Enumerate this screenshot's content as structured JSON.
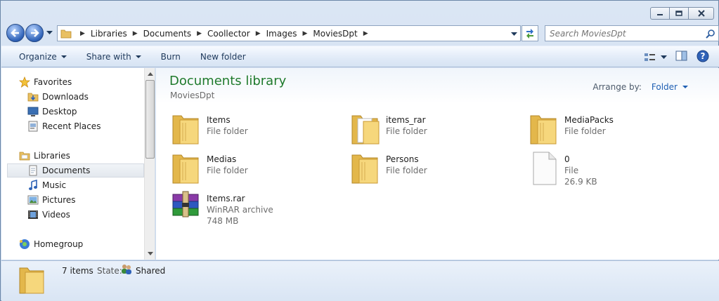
{
  "address": {
    "crumbs": [
      "Libraries",
      "Documents",
      "Coollector",
      "Images",
      "MoviesDpt"
    ]
  },
  "search": {
    "placeholder": "Search MoviesDpt"
  },
  "toolbar": {
    "organize": "Organize",
    "share_with": "Share with",
    "burn": "Burn",
    "new_folder": "New folder"
  },
  "nav": {
    "favorites": "Favorites",
    "downloads": "Downloads",
    "desktop": "Desktop",
    "recent_places": "Recent Places",
    "libraries": "Libraries",
    "documents": "Documents",
    "music": "Music",
    "pictures": "Pictures",
    "videos": "Videos",
    "homegroup": "Homegroup"
  },
  "content": {
    "title": "Documents library",
    "subtitle": "MoviesDpt",
    "arrange_label": "Arrange by:",
    "arrange_value": "Folder",
    "files": [
      {
        "name": "Items",
        "type": "File folder",
        "size": ""
      },
      {
        "name": "items_rar",
        "type": "File folder",
        "size": ""
      },
      {
        "name": "MediaPacks",
        "type": "File folder",
        "size": ""
      },
      {
        "name": "Medias",
        "type": "File folder",
        "size": ""
      },
      {
        "name": "Persons",
        "type": "File folder",
        "size": ""
      },
      {
        "name": "0",
        "type": "File",
        "size": "26.9 KB"
      },
      {
        "name": "Items.rar",
        "type": "WinRAR archive",
        "size": "748 MB"
      }
    ]
  },
  "details": {
    "count": "7 items",
    "state_label": "State:",
    "state_value": "Shared"
  },
  "colors": {
    "library_title": "#1f7a2c",
    "arrange_value": "#1e5fb3",
    "folder": "#f2cd6b"
  }
}
